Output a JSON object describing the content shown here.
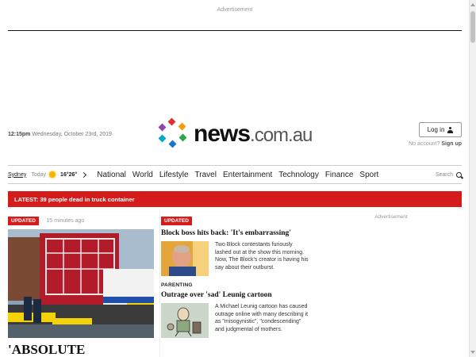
{
  "ads": {
    "top_label": "Advertisement",
    "right_label": "Advertisement"
  },
  "header": {
    "time": "12:15pm",
    "date": "Wednesday, October 23rd, 2019",
    "logo": {
      "brand": "news",
      "tld": ".com.au"
    },
    "login": {
      "label": "Log in",
      "icon": "user-icon"
    },
    "no_account": "No account?",
    "sign_up": "Sign up"
  },
  "nav": {
    "location": "Sydney",
    "today_label": "Today",
    "weather_icon": "sun-icon",
    "temps": "16°26°",
    "links": [
      "National",
      "World",
      "Lifestyle",
      "Travel",
      "Entertainment",
      "Technology",
      "Finance",
      "Sport"
    ],
    "search_label": "Search",
    "search_icon": "search-icon"
  },
  "breaking": {
    "text": "LATEST: 39 people dead in truck container"
  },
  "hero": {
    "badge": "UPDATED",
    "time_ago": "15 minutes ago",
    "headline": "'ABSOLUTE TRAGEDY':"
  },
  "stories": [
    {
      "badge": "UPDATED",
      "title": "Block boss hits back: 'It's embarrassing'",
      "body": "Two Block contestants furiously lashed out at the show this morning. Now, The Block's creator is having his say about their outburst."
    },
    {
      "kicker": "PARENTING",
      "title": "Outrage over 'sad' Leunig cartoon",
      "body": "A Michael Leunig cartoon has caused outrage online with many describing it as \"misogynistic\", \"condescending\" and judgmental of mothers."
    }
  ],
  "colors": {
    "accent_red": "#d41c1c",
    "logo_dots": [
      "#e0312d",
      "#f39c12",
      "#27a844",
      "#1a73c8",
      "#8e44ad",
      "#00a8c6"
    ]
  }
}
